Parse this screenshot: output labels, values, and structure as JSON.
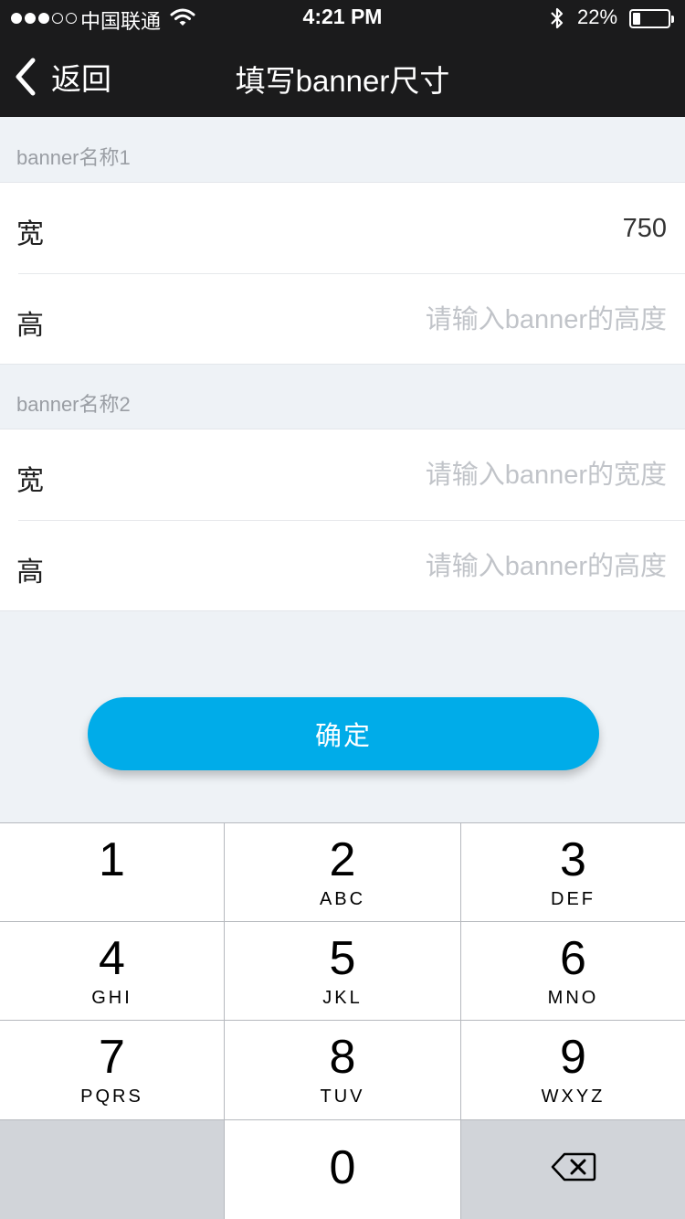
{
  "status_bar": {
    "carrier": "中国联通",
    "time": "4:21 PM",
    "battery_percent": "22%",
    "battery_level": 0.22,
    "signal_bars_filled": 3,
    "signal_bars_total": 5
  },
  "nav": {
    "back_label": "返回",
    "title": "填写banner尺寸"
  },
  "sections": [
    {
      "label": "banner名称1",
      "fields": [
        {
          "label": "宽",
          "value": "750",
          "placeholder": ""
        },
        {
          "label": "高",
          "value": "",
          "placeholder": "请输入banner的高度"
        }
      ]
    },
    {
      "label": "banner名称2",
      "fields": [
        {
          "label": "宽",
          "value": "",
          "placeholder": "请输入banner的宽度"
        },
        {
          "label": "高",
          "value": "",
          "placeholder": "请输入banner的高度"
        }
      ]
    }
  ],
  "confirm_label": "确定",
  "keypad": {
    "keys": [
      {
        "num": "1",
        "letters": ""
      },
      {
        "num": "2",
        "letters": "ABC"
      },
      {
        "num": "3",
        "letters": "DEF"
      },
      {
        "num": "4",
        "letters": "GHI"
      },
      {
        "num": "5",
        "letters": "JKL"
      },
      {
        "num": "6",
        "letters": "MNO"
      },
      {
        "num": "7",
        "letters": "PQRS"
      },
      {
        "num": "8",
        "letters": "TUV"
      },
      {
        "num": "9",
        "letters": "WXYZ"
      },
      {
        "num": "0",
        "letters": ""
      }
    ],
    "delete_icon": "backspace-icon"
  },
  "colors": {
    "accent": "#00ace9",
    "header_bg": "#1b1b1c",
    "page_bg": "#eef2f6"
  }
}
